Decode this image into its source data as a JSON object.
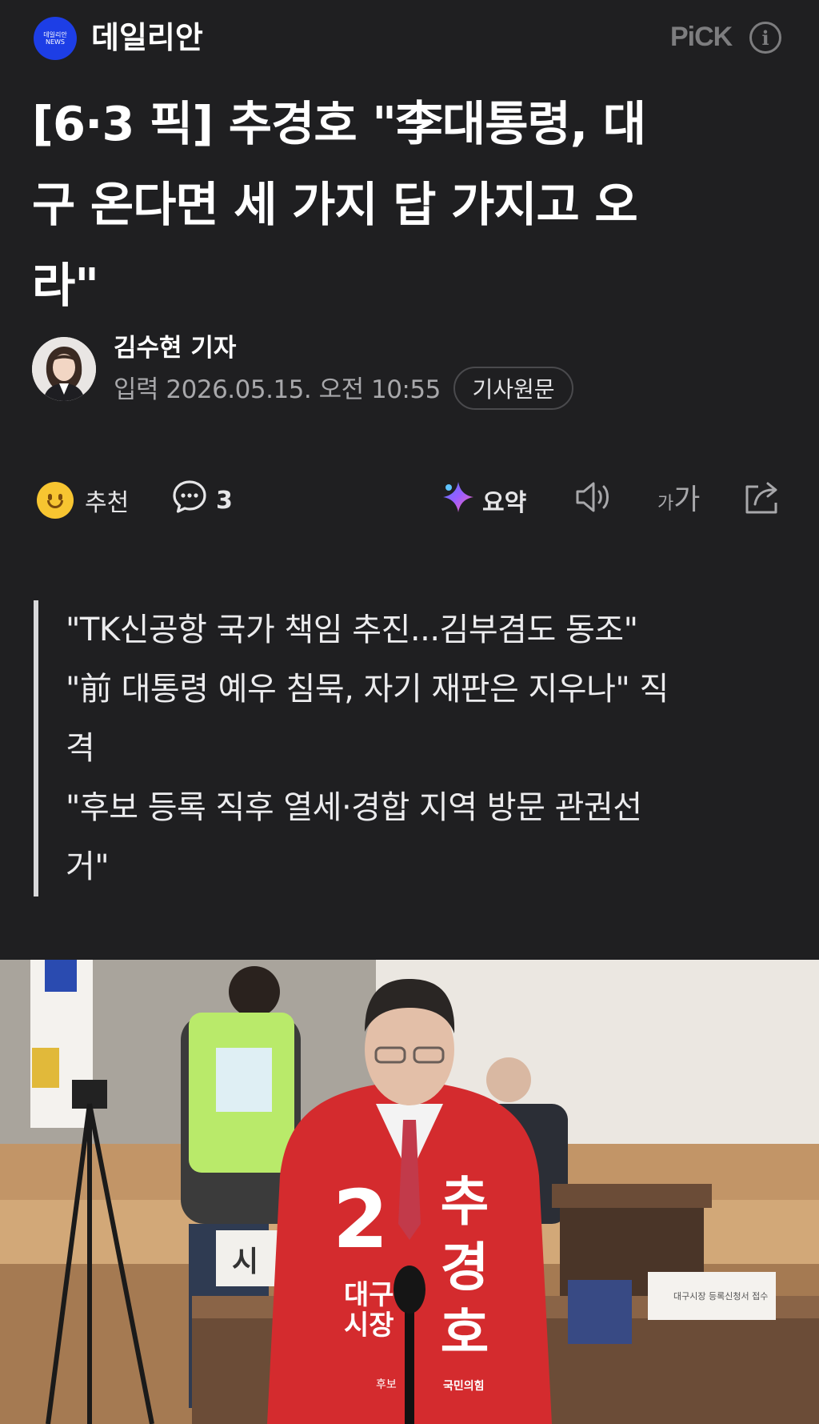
{
  "header": {
    "press_name": "데일리안",
    "logo_text_top": "데일리안",
    "logo_text_bottom": "NEWS",
    "pick_label": "PiCK",
    "info_icon": "info-circle-icon"
  },
  "article": {
    "headline_lines": [
      "[6·3 픽] 추경호 \"李대통령, 대",
      "구 온다면 세 가지 답 가지고 오",
      "라\""
    ],
    "reporter": "김수현 기자",
    "date": "입력 2026.05.15. 오전 10:55",
    "original_button": "기사원문"
  },
  "toolbar": {
    "recommend_label": "추천",
    "comment_count": "3",
    "summary_label": "요약",
    "font_size_label_small": "가",
    "font_size_label_large": "가",
    "icons": [
      "smile-icon",
      "comment-icon",
      "ai-summary-icon",
      "speaker-icon",
      "font-size-icon",
      "share-icon"
    ]
  },
  "subtitle_lines": [
    "\"TK신공항 국가 책임 추진...김부겸도 동조\"",
    "\"前 대통령 예우 침묵, 자기 재판은 지우나\" 직",
    "격",
    "\"후보 등록 직후 열세·경합 지역 방문 관권선",
    "거\""
  ],
  "photo": {
    "vest_number": "2",
    "name_chars": [
      "추",
      "경",
      "호"
    ],
    "vest_text_left_1": "대구",
    "vest_text_left_2": "시장",
    "vest_small_left": "후보",
    "party": "국민의힘",
    "desk_sign": "시 ",
    "desk_paper": "대구시장 등록신청서 접수"
  },
  "colors": {
    "background": "#1f1f21",
    "logo_blue": "#1d3ee6",
    "jacket_red": "#d42b2e"
  }
}
